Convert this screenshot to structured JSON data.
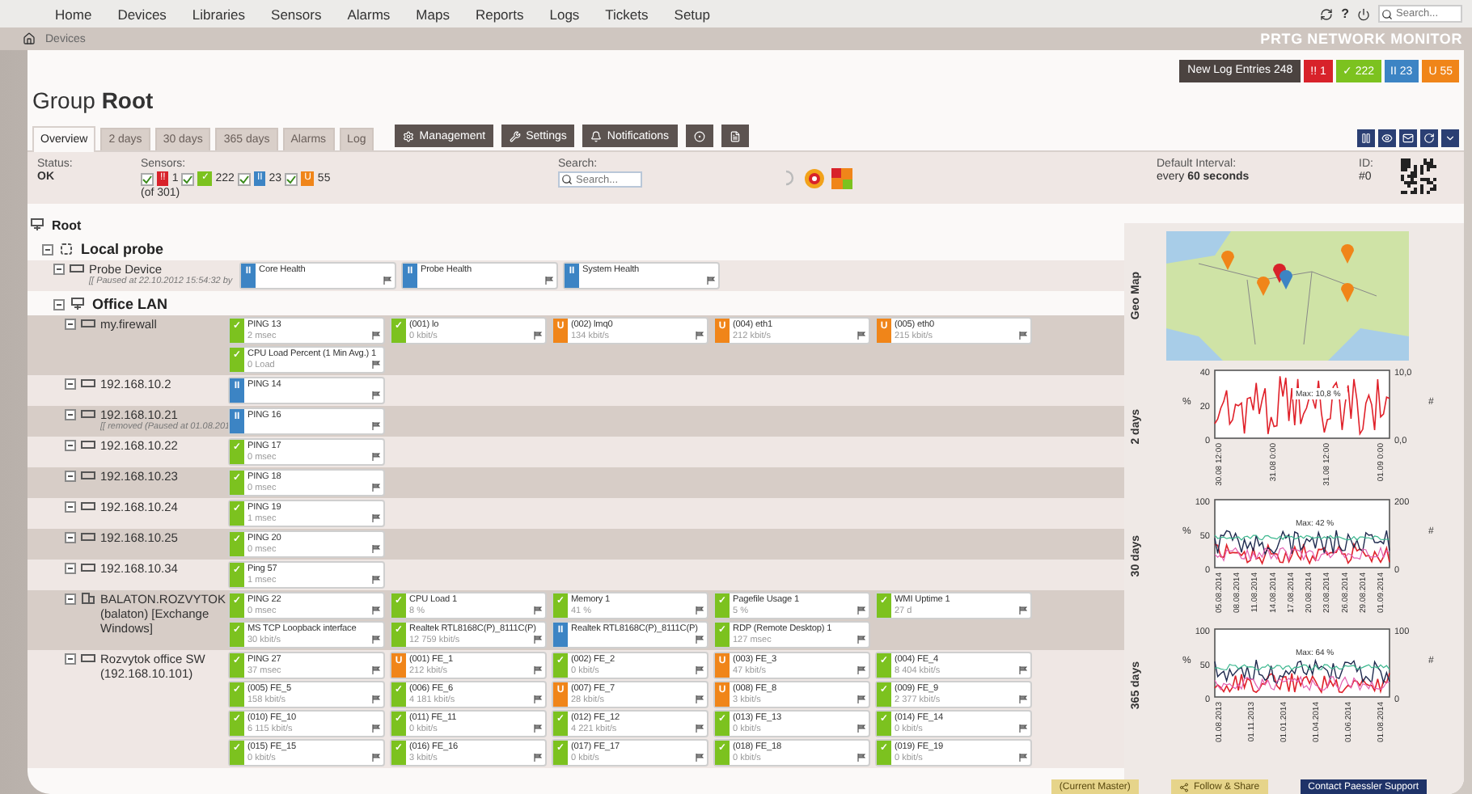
{
  "nav": {
    "items": [
      "Home",
      "Devices",
      "Libraries",
      "Sensors",
      "Alarms",
      "Maps",
      "Reports",
      "Logs",
      "Tickets",
      "Setup"
    ],
    "help": "?",
    "search": {
      "placeholder": "Search..."
    }
  },
  "breadcrumb": {
    "items": [
      "Devices"
    ],
    "brand": "PRTG NETWORK MONITOR"
  },
  "log_bar": {
    "label": "New Log Entries",
    "count": "248",
    "badges": [
      {
        "kind": "down",
        "glyph": "!!",
        "count": "1"
      },
      {
        "kind": "up",
        "glyph": "✓",
        "count": "222"
      },
      {
        "kind": "paused",
        "glyph": "II",
        "count": "23"
      },
      {
        "kind": "unusual",
        "glyph": "U",
        "count": "55"
      }
    ]
  },
  "page_title": "Group **Root**",
  "tabs": [
    {
      "label": "Overview",
      "selected": true
    },
    {
      "label": "2 days",
      "selected": false
    },
    {
      "label": "30 days",
      "selected": false
    },
    {
      "label": "365 days",
      "selected": false
    },
    {
      "label": "Alarms",
      "selected": false
    },
    {
      "label": "Log",
      "selected": false
    }
  ],
  "actions": [
    {
      "kind": "management",
      "label": "Management"
    },
    {
      "kind": "settings",
      "label": "Settings"
    },
    {
      "kind": "notifications",
      "label": "Notifications"
    },
    {
      "kind": "target"
    },
    {
      "kind": "document"
    }
  ],
  "info": {
    "status_label": "Status:",
    "status": "OK",
    "sensors_label": "Sensors:",
    "sensor_filters": [
      {
        "kind": "down",
        "glyph": "!!",
        "count": "1",
        "checked": true
      },
      {
        "kind": "up",
        "glyph": "✓",
        "count": "222",
        "checked": true
      },
      {
        "kind": "paused",
        "glyph": "II",
        "count": "23",
        "checked": true
      },
      {
        "kind": "unusual",
        "glyph": "U",
        "count": "55",
        "checked": true
      }
    ],
    "sensors_total": "(of 301)",
    "search_label": "Search:",
    "search_placeholder": "Search...",
    "interval_label": "Default Interval:",
    "interval": "every **60 seconds**",
    "id_label": "ID:",
    "id": "#0"
  },
  "tree": {
    "name": "Root",
    "kind": "root",
    "children": [
      {
        "name": "Local probe",
        "kind": "probe",
        "expanded": true,
        "children": [
          {
            "name": "Probe Device",
            "kind": "device",
            "expanded": true,
            "note": "[[ Paused at 22.10.2012 15:54:32 by",
            "sensors": [
              {
                "name": "Core Health",
                "kind": "paused",
                "glyph": "II"
              },
              {
                "name": "Probe Health",
                "kind": "paused",
                "glyph": "II"
              },
              {
                "name": "System Health",
                "kind": "paused",
                "glyph": "II"
              }
            ]
          },
          {
            "name": "Office LAN",
            "kind": "group",
            "expanded": true,
            "children": [
              {
                "name": "my.firewall",
                "kind": "device",
                "expanded": true,
                "sensors": [
                  {
                    "name": "PING 13",
                    "value": "2 msec",
                    "kind": "up",
                    "glyph": "✓"
                  },
                  {
                    "name": "(001) lo",
                    "value": "0 kbit/s",
                    "kind": "up",
                    "glyph": "✓"
                  },
                  {
                    "name": "(002) lmq0",
                    "value": "134 kbit/s",
                    "kind": "unusual",
                    "glyph": "U"
                  },
                  {
                    "name": "(004) eth1",
                    "value": "212 kbit/s",
                    "kind": "unusual",
                    "glyph": "U"
                  },
                  {
                    "name": "(005) eth0",
                    "value": "215 kbit/s",
                    "kind": "unusual",
                    "glyph": "U"
                  },
                  {
                    "name": "CPU Load Percent (1 Min Avg.) 1",
                    "value": "0 Load",
                    "kind": "up",
                    "glyph": "✓"
                  }
                ]
              },
              {
                "name": "192.168.10.2",
                "kind": "device",
                "expanded": true,
                "sensors": [
                  {
                    "name": "PING 14",
                    "kind": "paused",
                    "glyph": "II"
                  }
                ]
              },
              {
                "name": "192.168.10.21",
                "kind": "device",
                "expanded": true,
                "note": "[[ removed (Paused at 01.08.201",
                "sensors": [
                  {
                    "name": "PING 16",
                    "kind": "paused",
                    "glyph": "II"
                  }
                ]
              },
              {
                "name": "192.168.10.22",
                "kind": "device",
                "expanded": true,
                "sensors": [
                  {
                    "name": "PING 17",
                    "value": "0 msec",
                    "kind": "up",
                    "glyph": "✓"
                  }
                ]
              },
              {
                "name": "192.168.10.23",
                "kind": "device",
                "expanded": true,
                "sensors": [
                  {
                    "name": "PING 18",
                    "value": "0 msec",
                    "kind": "up",
                    "glyph": "✓"
                  }
                ]
              },
              {
                "name": "192.168.10.24",
                "kind": "device",
                "expanded": true,
                "sensors": [
                  {
                    "name": "PING 19",
                    "value": "1 msec",
                    "kind": "up",
                    "glyph": "✓"
                  }
                ]
              },
              {
                "name": "192.168.10.25",
                "kind": "device",
                "expanded": true,
                "sensors": [
                  {
                    "name": "PING 20",
                    "value": "0 msec",
                    "kind": "up",
                    "glyph": "✓"
                  }
                ]
              },
              {
                "name": "192.168.10.34",
                "kind": "device",
                "expanded": true,
                "sensors": [
                  {
                    "name": "Ping 57",
                    "value": "1 msec",
                    "kind": "up",
                    "glyph": "✓"
                  }
                ]
              },
              {
                "name": "BALATON.ROZVYTOK (balaton) [Exchange Windows]",
                "kind": "server",
                "expanded": true,
                "sensors": [
                  {
                    "name": "PING 22",
                    "value": "0 msec",
                    "kind": "up",
                    "glyph": "✓"
                  },
                  {
                    "name": "CPU Load 1",
                    "value": "8 %",
                    "kind": "up",
                    "glyph": "✓"
                  },
                  {
                    "name": "Memory 1",
                    "value": "41 %",
                    "kind": "up",
                    "glyph": "✓"
                  },
                  {
                    "name": "Pagefile Usage 1",
                    "value": "5 %",
                    "kind": "up",
                    "glyph": "✓"
                  },
                  {
                    "name": "WMI Uptime 1",
                    "value": "27 d",
                    "kind": "up",
                    "glyph": "✓"
                  },
                  {
                    "name": "MS TCP Loopback interface",
                    "value": "30 kbit/s",
                    "kind": "up",
                    "glyph": "✓"
                  },
                  {
                    "name": "Realtek RTL8168C(P)_8111C(P)",
                    "value": "12 759 kbit/s",
                    "kind": "up",
                    "glyph": "✓"
                  },
                  {
                    "name": "Realtek RTL8168C(P)_8111C(P)",
                    "kind": "paused",
                    "glyph": "II"
                  },
                  {
                    "name": "RDP (Remote Desktop) 1",
                    "value": "127 msec",
                    "kind": "up",
                    "glyph": "✓"
                  }
                ]
              },
              {
                "name": "Rozvytok office SW (192.168.10.101)",
                "kind": "device",
                "expanded": true,
                "sensors": [
                  {
                    "name": "PING 27",
                    "value": "37 msec",
                    "kind": "up",
                    "glyph": "✓"
                  },
                  {
                    "name": "(001) FE_1",
                    "value": "212 kbit/s",
                    "kind": "unusual",
                    "glyph": "U"
                  },
                  {
                    "name": "(002) FE_2",
                    "value": "0 kbit/s",
                    "kind": "up",
                    "glyph": "✓"
                  },
                  {
                    "name": "(003) FE_3",
                    "value": "47 kbit/s",
                    "kind": "unusual",
                    "glyph": "U"
                  },
                  {
                    "name": "(004) FE_4",
                    "value": "8 404 kbit/s",
                    "kind": "up",
                    "glyph": "✓"
                  },
                  {
                    "name": "(005) FE_5",
                    "value": "158 kbit/s",
                    "kind": "up",
                    "glyph": "✓"
                  },
                  {
                    "name": "(006) FE_6",
                    "value": "4 181 kbit/s",
                    "kind": "up",
                    "glyph": "✓"
                  },
                  {
                    "name": "(007) FE_7",
                    "value": "28 kbit/s",
                    "kind": "unusual",
                    "glyph": "U"
                  },
                  {
                    "name": "(008) FE_8",
                    "value": "3 kbit/s",
                    "kind": "unusual",
                    "glyph": "U"
                  },
                  {
                    "name": "(009) FE_9",
                    "value": "2 377 kbit/s",
                    "kind": "up",
                    "glyph": "✓"
                  },
                  {
                    "name": "(010) FE_10",
                    "value": "6 115 kbit/s",
                    "kind": "up",
                    "glyph": "✓"
                  },
                  {
                    "name": "(011) FE_11",
                    "value": "0 kbit/s",
                    "kind": "up",
                    "glyph": "✓"
                  },
                  {
                    "name": "(012) FE_12",
                    "value": "4 221 kbit/s",
                    "kind": "up",
                    "glyph": "✓"
                  },
                  {
                    "name": "(013) FE_13",
                    "value": "0 kbit/s",
                    "kind": "up",
                    "glyph": "✓"
                  },
                  {
                    "name": "(014) FE_14",
                    "value": "0 kbit/s",
                    "kind": "up",
                    "glyph": "✓"
                  },
                  {
                    "name": "(015) FE_15",
                    "value": "0 kbit/s",
                    "kind": "up",
                    "glyph": "✓"
                  },
                  {
                    "name": "(016) FE_16",
                    "value": "3 kbit/s",
                    "kind": "up",
                    "glyph": "✓"
                  },
                  {
                    "name": "(017) FE_17",
                    "value": "0 kbit/s",
                    "kind": "up",
                    "glyph": "✓"
                  },
                  {
                    "name": "(018) FE_18",
                    "value": "0 kbit/s",
                    "kind": "up",
                    "glyph": "✓"
                  },
                  {
                    "name": "(019) FE_19",
                    "value": "0 kbit/s",
                    "kind": "up",
                    "glyph": "✓"
                  }
                ]
              }
            ]
          }
        ]
      }
    ]
  },
  "side": {
    "map_label": "Geo Map",
    "charts": [
      {
        "label": "2 days",
        "yunit": "%",
        "y2unit": "#",
        "yticks": [
          "40",
          "20",
          "0"
        ],
        "y2ticks": [
          "10,0",
          "0,0"
        ],
        "xticks": [
          "30.08 12:00",
          "31.08 0:00",
          "31.08 12:00",
          "01.09 0:00"
        ],
        "note": "Max: 10,8 %"
      },
      {
        "label": "30 days",
        "yunit": "%",
        "y2unit": "#",
        "yticks": [
          "100",
          "50",
          "0"
        ],
        "y2ticks": [
          "200",
          "0"
        ],
        "xticks": [
          "05.08.2014",
          "08.08.2014",
          "11.08.2014",
          "14.08.2014",
          "17.08.2014",
          "20.08.2014",
          "23.08.2014",
          "26.08.2014",
          "29.08.2014",
          "01.09.2014"
        ],
        "note": "Max: 42 %"
      },
      {
        "label": "365 days",
        "yunit": "%",
        "y2unit": "#",
        "yticks": [
          "100",
          "50",
          "0"
        ],
        "y2ticks": [
          "100",
          "0"
        ],
        "xticks": [
          "01.08.2013",
          "01.11.2013",
          "01.01.2014",
          "01.04.2014",
          "01.06.2014",
          "01.08.2014"
        ],
        "note": "Max: 64 %"
      }
    ]
  },
  "footer": [
    {
      "kind": "version",
      "label": "(Current Master)"
    },
    {
      "kind": "share",
      "label": "Follow & Share"
    },
    {
      "kind": "support",
      "label": "Contact Paessler Support"
    }
  ]
}
